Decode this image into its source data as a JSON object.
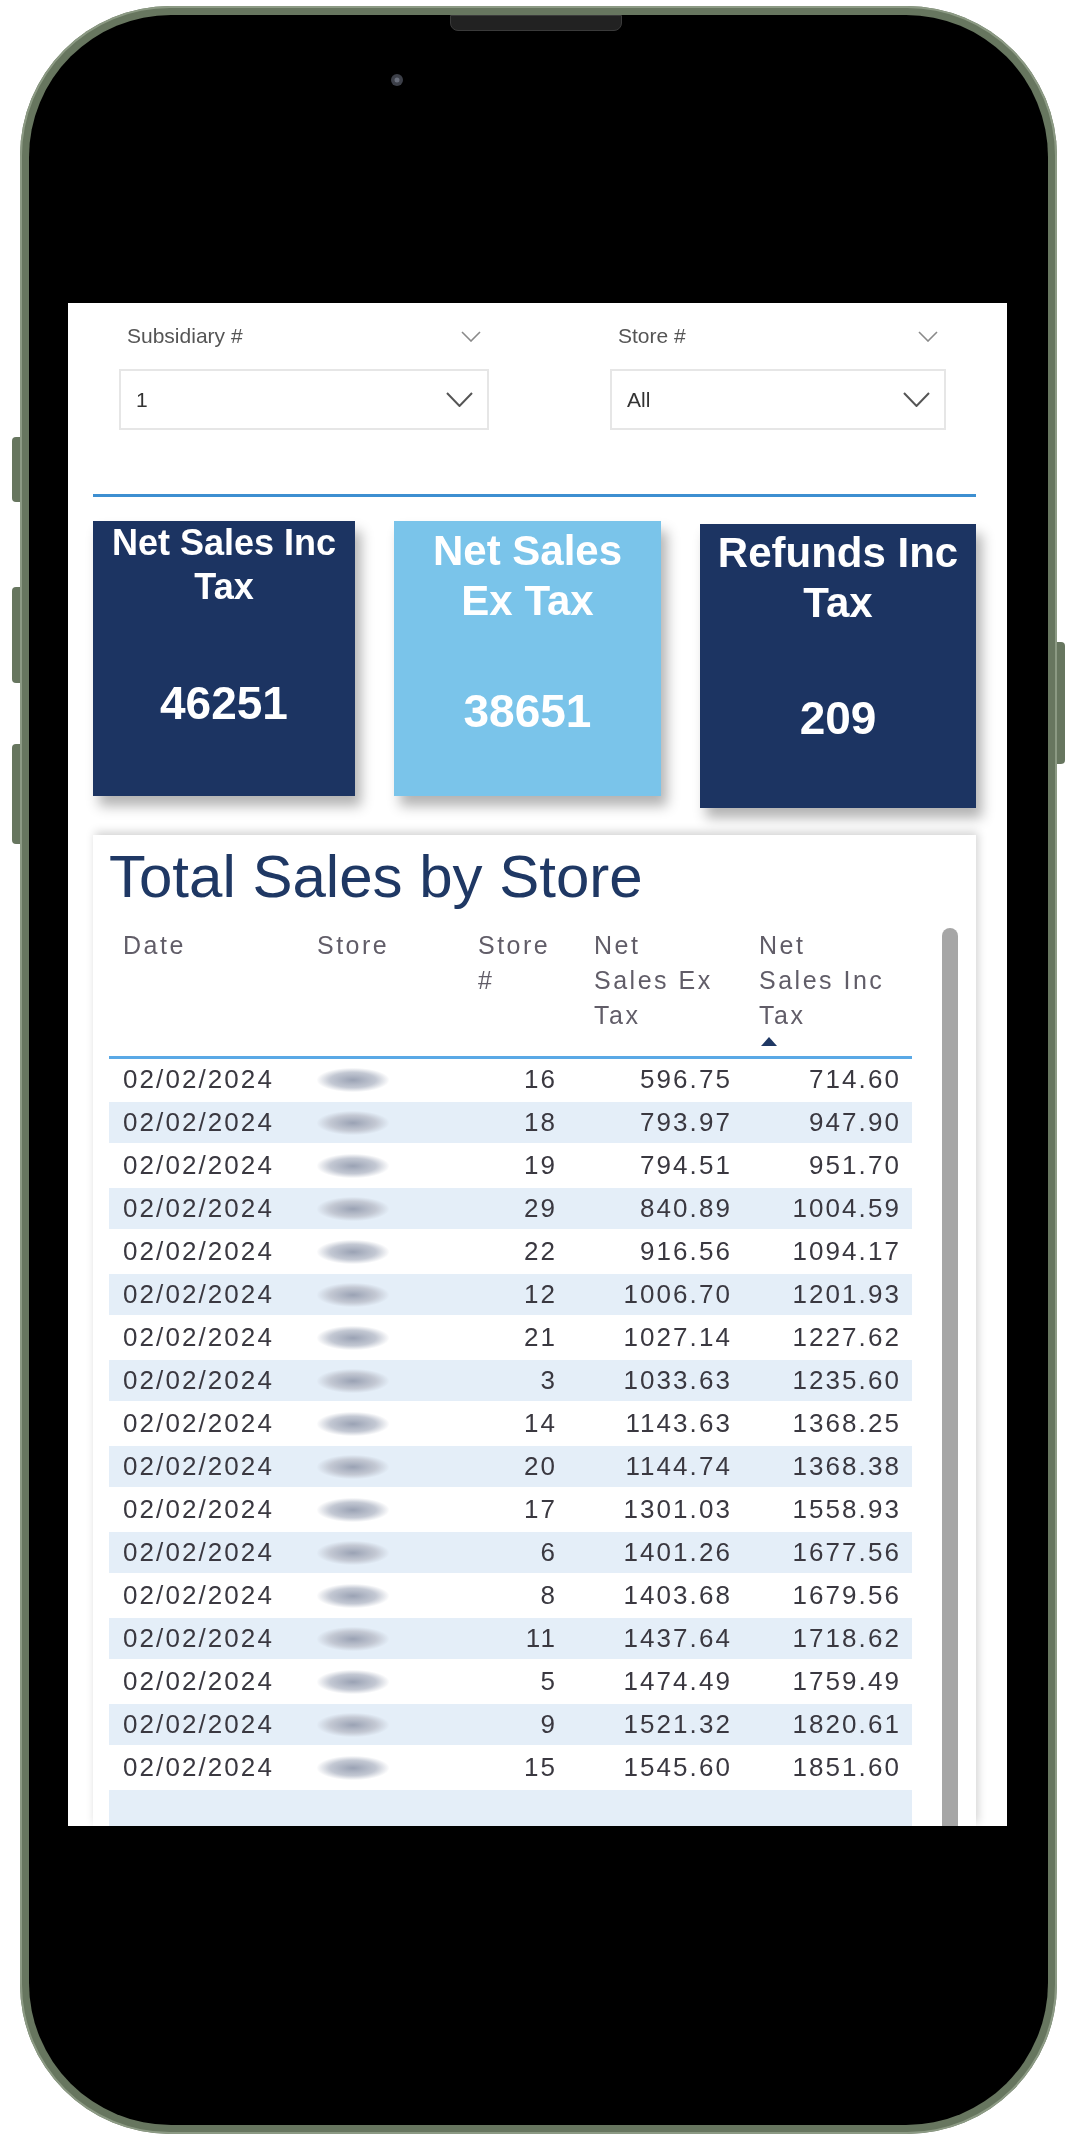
{
  "slicers": [
    {
      "label": "Subsidiary #",
      "value": "1"
    },
    {
      "label": "Store #",
      "value": "All"
    }
  ],
  "kpi_cards": [
    {
      "title": "Net Sales Inc Tax",
      "value": "46251",
      "color": "#1c3462"
    },
    {
      "title": "Net Sales Ex Tax",
      "value": "38651",
      "color": "#7ac4ea"
    },
    {
      "title": "Refunds Inc Tax",
      "value": "209",
      "color": "#1c3462"
    }
  ],
  "table": {
    "title": "Total Sales by Store",
    "columns": [
      {
        "label": "Date",
        "sorted": false
      },
      {
        "label": "Store",
        "sorted": false
      },
      {
        "label": "Store #",
        "sorted": false
      },
      {
        "label": "Net Sales Ex Tax",
        "sorted": false
      },
      {
        "label": "Net Sales Inc Tax",
        "sorted": true
      }
    ],
    "rows": [
      {
        "date": "02/02/2024",
        "store_number": "16",
        "net_sales_ex_tax": "596.75",
        "net_sales_inc_tax": "714.60"
      },
      {
        "date": "02/02/2024",
        "store_number": "18",
        "net_sales_ex_tax": "793.97",
        "net_sales_inc_tax": "947.90"
      },
      {
        "date": "02/02/2024",
        "store_number": "19",
        "net_sales_ex_tax": "794.51",
        "net_sales_inc_tax": "951.70"
      },
      {
        "date": "02/02/2024",
        "store_number": "29",
        "net_sales_ex_tax": "840.89",
        "net_sales_inc_tax": "1004.59"
      },
      {
        "date": "02/02/2024",
        "store_number": "22",
        "net_sales_ex_tax": "916.56",
        "net_sales_inc_tax": "1094.17"
      },
      {
        "date": "02/02/2024",
        "store_number": "12",
        "net_sales_ex_tax": "1006.70",
        "net_sales_inc_tax": "1201.93"
      },
      {
        "date": "02/02/2024",
        "store_number": "21",
        "net_sales_ex_tax": "1027.14",
        "net_sales_inc_tax": "1227.62"
      },
      {
        "date": "02/02/2024",
        "store_number": "3",
        "net_sales_ex_tax": "1033.63",
        "net_sales_inc_tax": "1235.60"
      },
      {
        "date": "02/02/2024",
        "store_number": "14",
        "net_sales_ex_tax": "1143.63",
        "net_sales_inc_tax": "1368.25"
      },
      {
        "date": "02/02/2024",
        "store_number": "20",
        "net_sales_ex_tax": "1144.74",
        "net_sales_inc_tax": "1368.38"
      },
      {
        "date": "02/02/2024",
        "store_number": "17",
        "net_sales_ex_tax": "1301.03",
        "net_sales_inc_tax": "1558.93"
      },
      {
        "date": "02/02/2024",
        "store_number": "6",
        "net_sales_ex_tax": "1401.26",
        "net_sales_inc_tax": "1677.56"
      },
      {
        "date": "02/02/2024",
        "store_number": "8",
        "net_sales_ex_tax": "1403.68",
        "net_sales_inc_tax": "1679.56"
      },
      {
        "date": "02/02/2024",
        "store_number": "11",
        "net_sales_ex_tax": "1437.64",
        "net_sales_inc_tax": "1718.62"
      },
      {
        "date": "02/02/2024",
        "store_number": "5",
        "net_sales_ex_tax": "1474.49",
        "net_sales_inc_tax": "1759.49"
      },
      {
        "date": "02/02/2024",
        "store_number": "9",
        "net_sales_ex_tax": "1521.32",
        "net_sales_inc_tax": "1820.61"
      },
      {
        "date": "02/02/2024",
        "store_number": "15",
        "net_sales_ex_tax": "1545.60",
        "net_sales_inc_tax": "1851.60"
      }
    ]
  }
}
